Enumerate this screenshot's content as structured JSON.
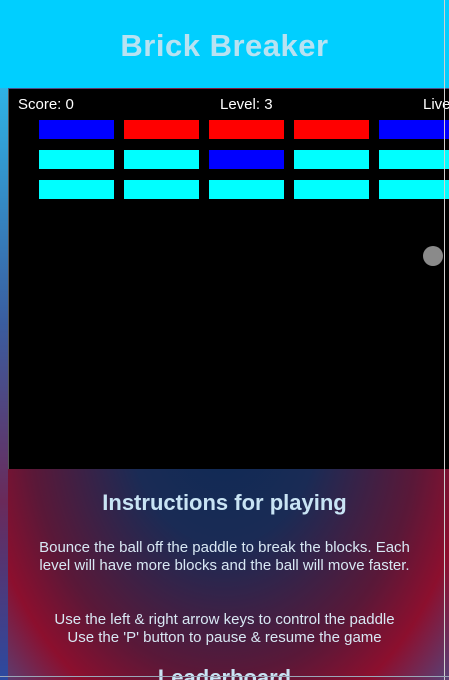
{
  "header": {
    "title": "Brick Breaker"
  },
  "hud": {
    "score": "Score: 0",
    "level": "Level: 3",
    "lives": "Lives"
  },
  "game": {
    "colors": {
      "blue": "#0000ff",
      "red": "#ff0000",
      "cyan": "#00ffff"
    },
    "bricks": [
      [
        "blue",
        "red",
        "red",
        "red",
        "blue"
      ],
      [
        "cyan",
        "cyan",
        "blue",
        "cyan",
        "cyan"
      ],
      [
        "cyan",
        "cyan",
        "cyan",
        "cyan",
        "cyan"
      ]
    ],
    "ball_color": "#8a8a8a",
    "paddle_color": "#d9d9d9"
  },
  "instructions": {
    "heading": "Instructions for playing",
    "para1": "Bounce the ball off the paddle to break the blocks. Each level will have more blocks and the ball will move faster.",
    "para2_line1": "Use the left & right arrow keys to control the paddle",
    "para2_line2": "Use the 'P' button to pause & resume the game"
  },
  "leaderboard": {
    "heading": "Leaderboard"
  }
}
